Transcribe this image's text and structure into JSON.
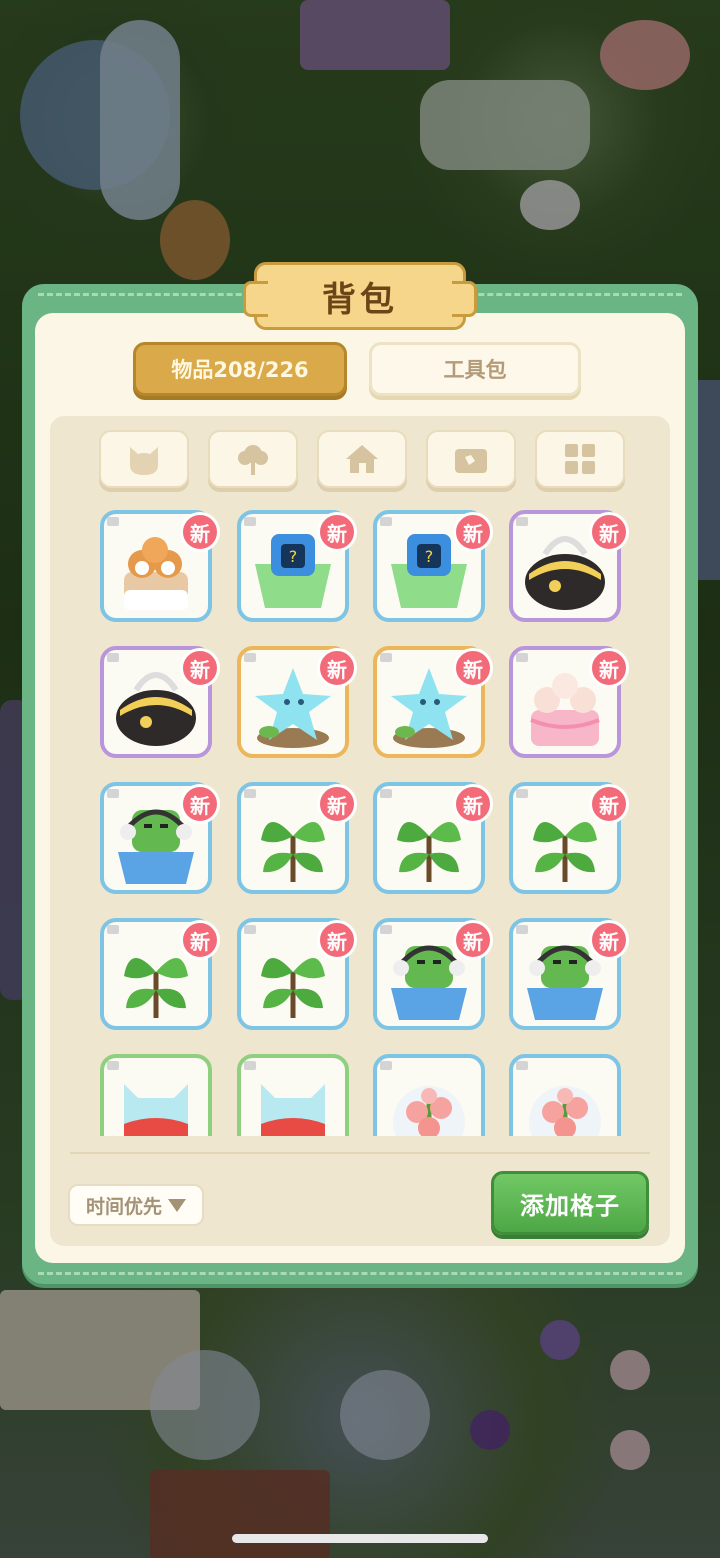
{
  "panel": {
    "title": "背包"
  },
  "tabs": [
    {
      "label": "物品208/226",
      "active": true
    },
    {
      "label": "工具包",
      "active": false
    }
  ],
  "categories": [
    {
      "icon": "cat-face-icon"
    },
    {
      "icon": "tree-icon"
    },
    {
      "icon": "house-icon"
    },
    {
      "icon": "treasure-chest-icon"
    },
    {
      "icon": "grid-icon"
    }
  ],
  "item_badge": "新",
  "items": [
    {
      "name": "shiba-cake-icon",
      "border": "blue",
      "new": true
    },
    {
      "name": "mystery-bag-green-icon",
      "border": "blue",
      "new": true
    },
    {
      "name": "mystery-bag-green-icon",
      "border": "blue",
      "new": true
    },
    {
      "name": "black-gold-bag-icon",
      "border": "purple",
      "new": true
    },
    {
      "name": "black-gold-bag-icon",
      "border": "purple",
      "new": true
    },
    {
      "name": "star-sprout-icon",
      "border": "orange",
      "new": true
    },
    {
      "name": "star-sprout-icon",
      "border": "orange",
      "new": true
    },
    {
      "name": "sheep-cake-icon",
      "border": "purple",
      "new": true
    },
    {
      "name": "robot-cat-headphones-icon",
      "border": "blue",
      "new": true
    },
    {
      "name": "green-plant-icon",
      "border": "blue",
      "new": true
    },
    {
      "name": "green-plant-icon",
      "border": "blue",
      "new": true
    },
    {
      "name": "green-plant-icon",
      "border": "blue",
      "new": true
    },
    {
      "name": "green-plant-icon",
      "border": "blue",
      "new": true
    },
    {
      "name": "green-plant-icon",
      "border": "blue",
      "new": true
    },
    {
      "name": "robot-cat-headphones-icon",
      "border": "blue",
      "new": true
    },
    {
      "name": "robot-cat-headphones-icon",
      "border": "blue",
      "new": true
    },
    {
      "name": "cat-potion-icon",
      "border": "green",
      "new": false
    },
    {
      "name": "cat-potion-icon",
      "border": "green",
      "new": false
    },
    {
      "name": "pink-flower-icon",
      "border": "blue",
      "new": false
    },
    {
      "name": "pink-flower-icon",
      "border": "blue",
      "new": false
    }
  ],
  "footer": {
    "sort_label": "时间优先",
    "add_slot_label": "添加格子"
  },
  "colors": {
    "panel_green": "#6bb584",
    "badge_red": "#f36b79",
    "tab_gold": "#d9a94a",
    "add_green": "#4ea746"
  }
}
